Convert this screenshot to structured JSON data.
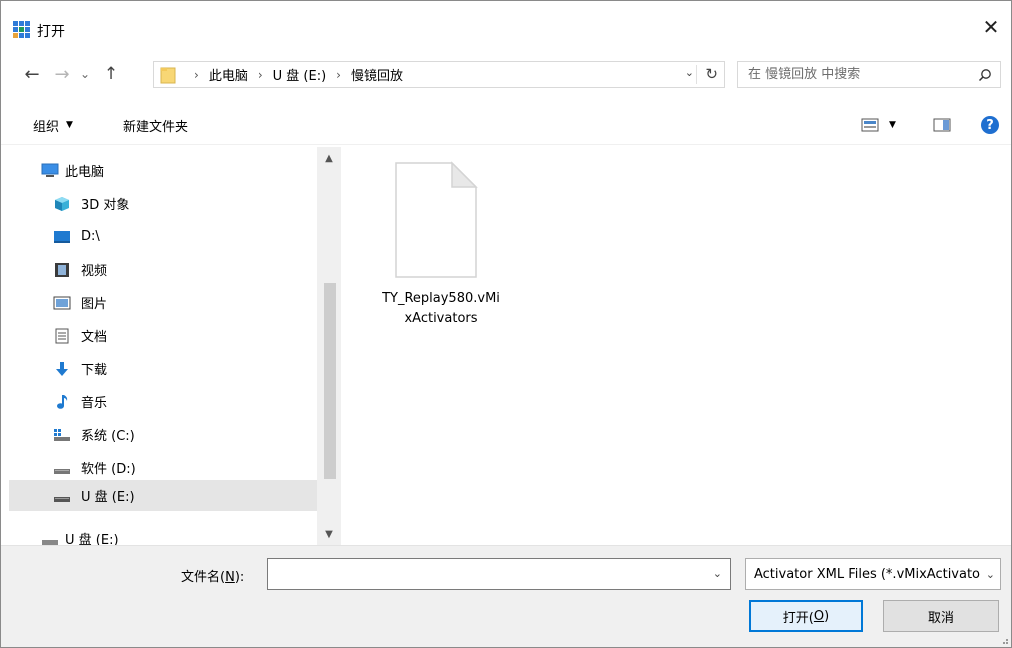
{
  "window": {
    "title": "打开",
    "close_glyph": "✕"
  },
  "nav": {
    "back_glyph": "←",
    "forward_glyph": "→",
    "recent_glyph": "⌄",
    "up_glyph": "↑"
  },
  "address": {
    "crumbs": [
      "此电脑",
      "U 盘 (E:)",
      "慢镜回放"
    ],
    "separator": "›",
    "dropdown_glyph": "⌄",
    "refresh_glyph": "↻"
  },
  "search": {
    "placeholder": "在 慢镜回放 中搜索"
  },
  "toolbar": {
    "organize_label": "组织",
    "organize_caret": "▼",
    "new_folder_label": "新建文件夹",
    "view_caret": "▼",
    "help_glyph": "?"
  },
  "tree": {
    "items": [
      {
        "label": "此电脑",
        "icon": "computer-icon"
      },
      {
        "label": "3D 对象",
        "icon": "3d-objects-icon"
      },
      {
        "label": "D:\\",
        "icon": "drive-icon"
      },
      {
        "label": "视频",
        "icon": "video-icon"
      },
      {
        "label": "图片",
        "icon": "picture-icon"
      },
      {
        "label": "文档",
        "icon": "document-icon"
      },
      {
        "label": "下载",
        "icon": "download-icon"
      },
      {
        "label": "音乐",
        "icon": "music-icon"
      },
      {
        "label": "系统 (C:)",
        "icon": "system-drive-icon"
      },
      {
        "label": "软件 (D:)",
        "icon": "drive-icon"
      },
      {
        "label": "U 盘 (E:)",
        "icon": "usb-drive-icon"
      },
      {
        "label": "U 盘 (E:)",
        "icon": "usb-drive-icon"
      }
    ],
    "scroll_up_glyph": "▲",
    "scroll_down_glyph": "▼"
  },
  "files": [
    {
      "name": "TY_Replay580.vMixActivators",
      "icon": "generic-file-icon"
    }
  ],
  "bottom": {
    "filename_label_pre": "文件名(",
    "filename_label_key": "N",
    "filename_label_post": "):",
    "filename_value": "",
    "filename_drop_glyph": "⌄",
    "filetype_value": "Activator XML Files (*.vMixActivators)",
    "filetype_drop_glyph": "⌄",
    "open_label_pre": "打开(",
    "open_label_key": "O",
    "open_label_post": ")",
    "cancel_label": "取消"
  },
  "colors": {
    "accent": "#0078d7",
    "selection": "#e5e5e5",
    "help_blue": "#1f6fd0",
    "folder_yellow": "#f8d775"
  }
}
